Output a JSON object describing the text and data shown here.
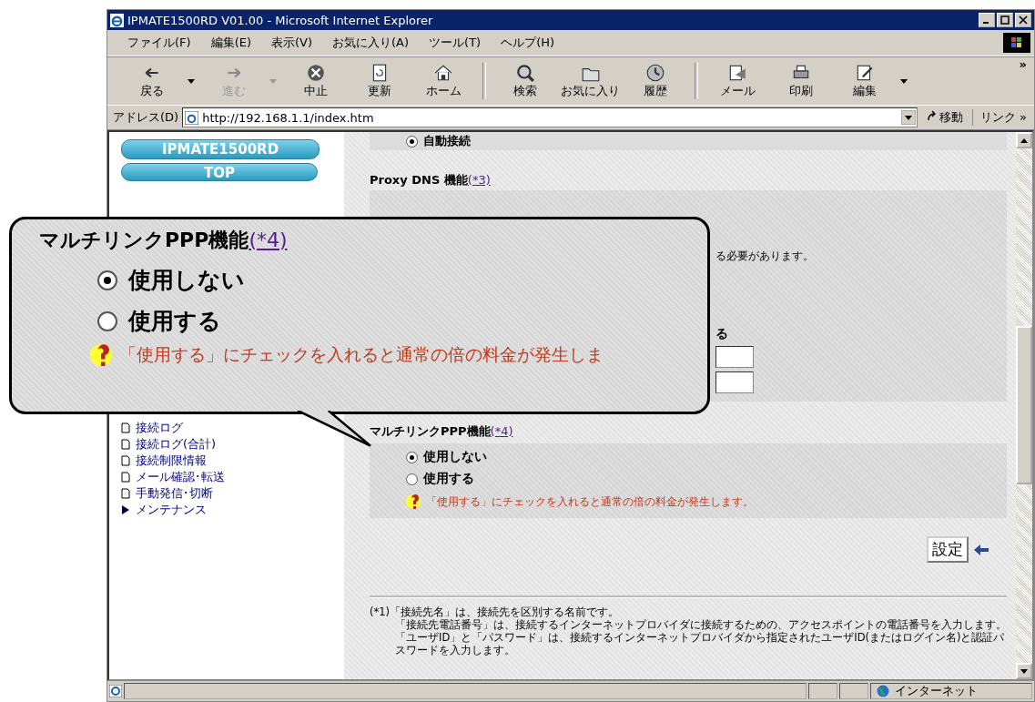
{
  "window": {
    "title": "IPMATE1500RD V01.00 - Microsoft Internet Explorer"
  },
  "menu": [
    "ファイル(F)",
    "編集(E)",
    "表示(V)",
    "お気に入り(A)",
    "ツール(T)",
    "ヘルプ(H)"
  ],
  "toolbar": [
    {
      "label": "戻る",
      "disabled": false,
      "dropdown": true
    },
    {
      "label": "進む",
      "disabled": true,
      "dropdown": true
    },
    {
      "label": "中止",
      "disabled": false,
      "dropdown": false
    },
    {
      "label": "更新",
      "disabled": false,
      "dropdown": false
    },
    {
      "label": "ホーム",
      "disabled": false,
      "dropdown": false
    },
    {
      "label": "検索",
      "disabled": false,
      "dropdown": false
    },
    {
      "label": "お気に入り",
      "disabled": false,
      "dropdown": false
    },
    {
      "label": "履歴",
      "disabled": false,
      "dropdown": false
    },
    {
      "label": "メール",
      "disabled": false,
      "dropdown": false
    },
    {
      "label": "印刷",
      "disabled": false,
      "dropdown": false
    },
    {
      "label": "編集",
      "disabled": false,
      "dropdown": true
    }
  ],
  "toolbar_more": "»",
  "address": {
    "label": "アドレス(D)",
    "url": "http://192.168.1.1/index.htm",
    "go": "移動",
    "links": "リンク »"
  },
  "sidebar": {
    "logo": "IPMATE1500RD",
    "top": "TOP",
    "items": [
      {
        "label": "接続ログ",
        "kind": "page"
      },
      {
        "label": "接続ログ(合計)",
        "kind": "page"
      },
      {
        "label": "接続制限情報",
        "kind": "page"
      },
      {
        "label": "メール確認･転送",
        "kind": "page"
      },
      {
        "label": "手動発信･切断",
        "kind": "page"
      },
      {
        "label": "メンテナンス",
        "kind": "folder"
      }
    ]
  },
  "content": {
    "auto_connect": {
      "label": "自動接続",
      "selected": true
    },
    "proxy": {
      "title": "Proxy DNS 機能",
      "note": "(*3)"
    },
    "fragments": [
      "る必要があります。",
      "る"
    ],
    "multilink": {
      "title": "マルチリンクPPP機能",
      "note": "(*4)",
      "options": [
        {
          "label": "使用しない",
          "selected": true
        },
        {
          "label": "使用する",
          "selected": false
        }
      ],
      "warning": "「使用する」にチェックを入れると通常の倍の料金が発生します。"
    },
    "submit": "設定",
    "footnotes": [
      "(*1)「接続先名」は、接続先を区別する名前です。",
      "「接続先電話番号」は、接続するインターネットプロバイダに接続するための、アクセスポイントの電話番号を入力します。",
      "「ユーザID」と「パスワード」は、接続するインターネットプロバイダから指定されたユーザID(またはログイン名)と認証パスワードを入力します。"
    ]
  },
  "callout": {
    "title": "マルチリンクPPP機能",
    "note": "(*4)",
    "options": [
      {
        "label": "使用しない",
        "selected": true
      },
      {
        "label": "使用する",
        "selected": false
      }
    ],
    "warning": "「使用する」にチェックを入れると通常の倍の料金が発生しま"
  },
  "status_bar": {
    "zone": "インターネット"
  }
}
